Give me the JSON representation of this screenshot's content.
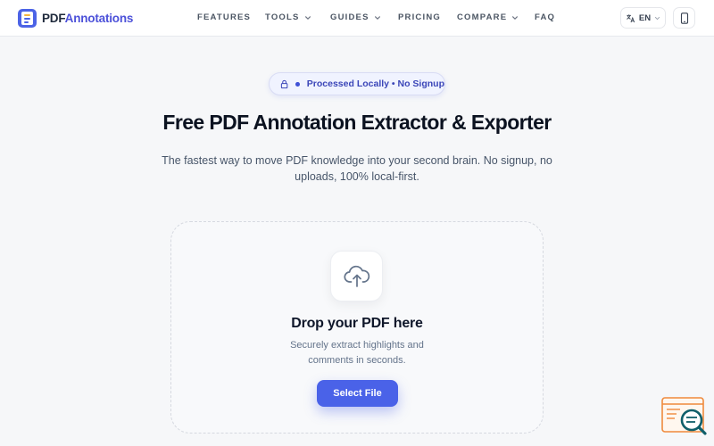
{
  "brand": {
    "name_part1": "PDF",
    "name_part2": "Annotations"
  },
  "nav": {
    "features": "FEATURES",
    "tools": "TOOLS",
    "guides": "GUIDES",
    "pricing": "PRICING",
    "compare": "COMPARE",
    "faq": "FAQ"
  },
  "header_actions": {
    "language": "EN"
  },
  "hero": {
    "badge": "Processed Locally • No Signup",
    "title": "Free PDF Annotation Extractor & Exporter",
    "subtitle": "The fastest way to move PDF knowledge into your second brain. No signup, no uploads, 100% local-first."
  },
  "dropzone": {
    "title": "Drop your PDF here",
    "subtitle": "Securely extract highlights and comments in seconds.",
    "button": "Select File"
  },
  "icons": {
    "logo": "document-icon",
    "chevron": "chevron-down-icon",
    "language": "translate-icon",
    "mobile": "smartphone-icon",
    "lock": "lock-icon",
    "upload": "cloud-upload-icon",
    "widget": "search-document-icon"
  },
  "colors": {
    "accent": "#4a62e8",
    "brand_text": "#4c51d9",
    "badge_bg": "#f0f3ff"
  }
}
